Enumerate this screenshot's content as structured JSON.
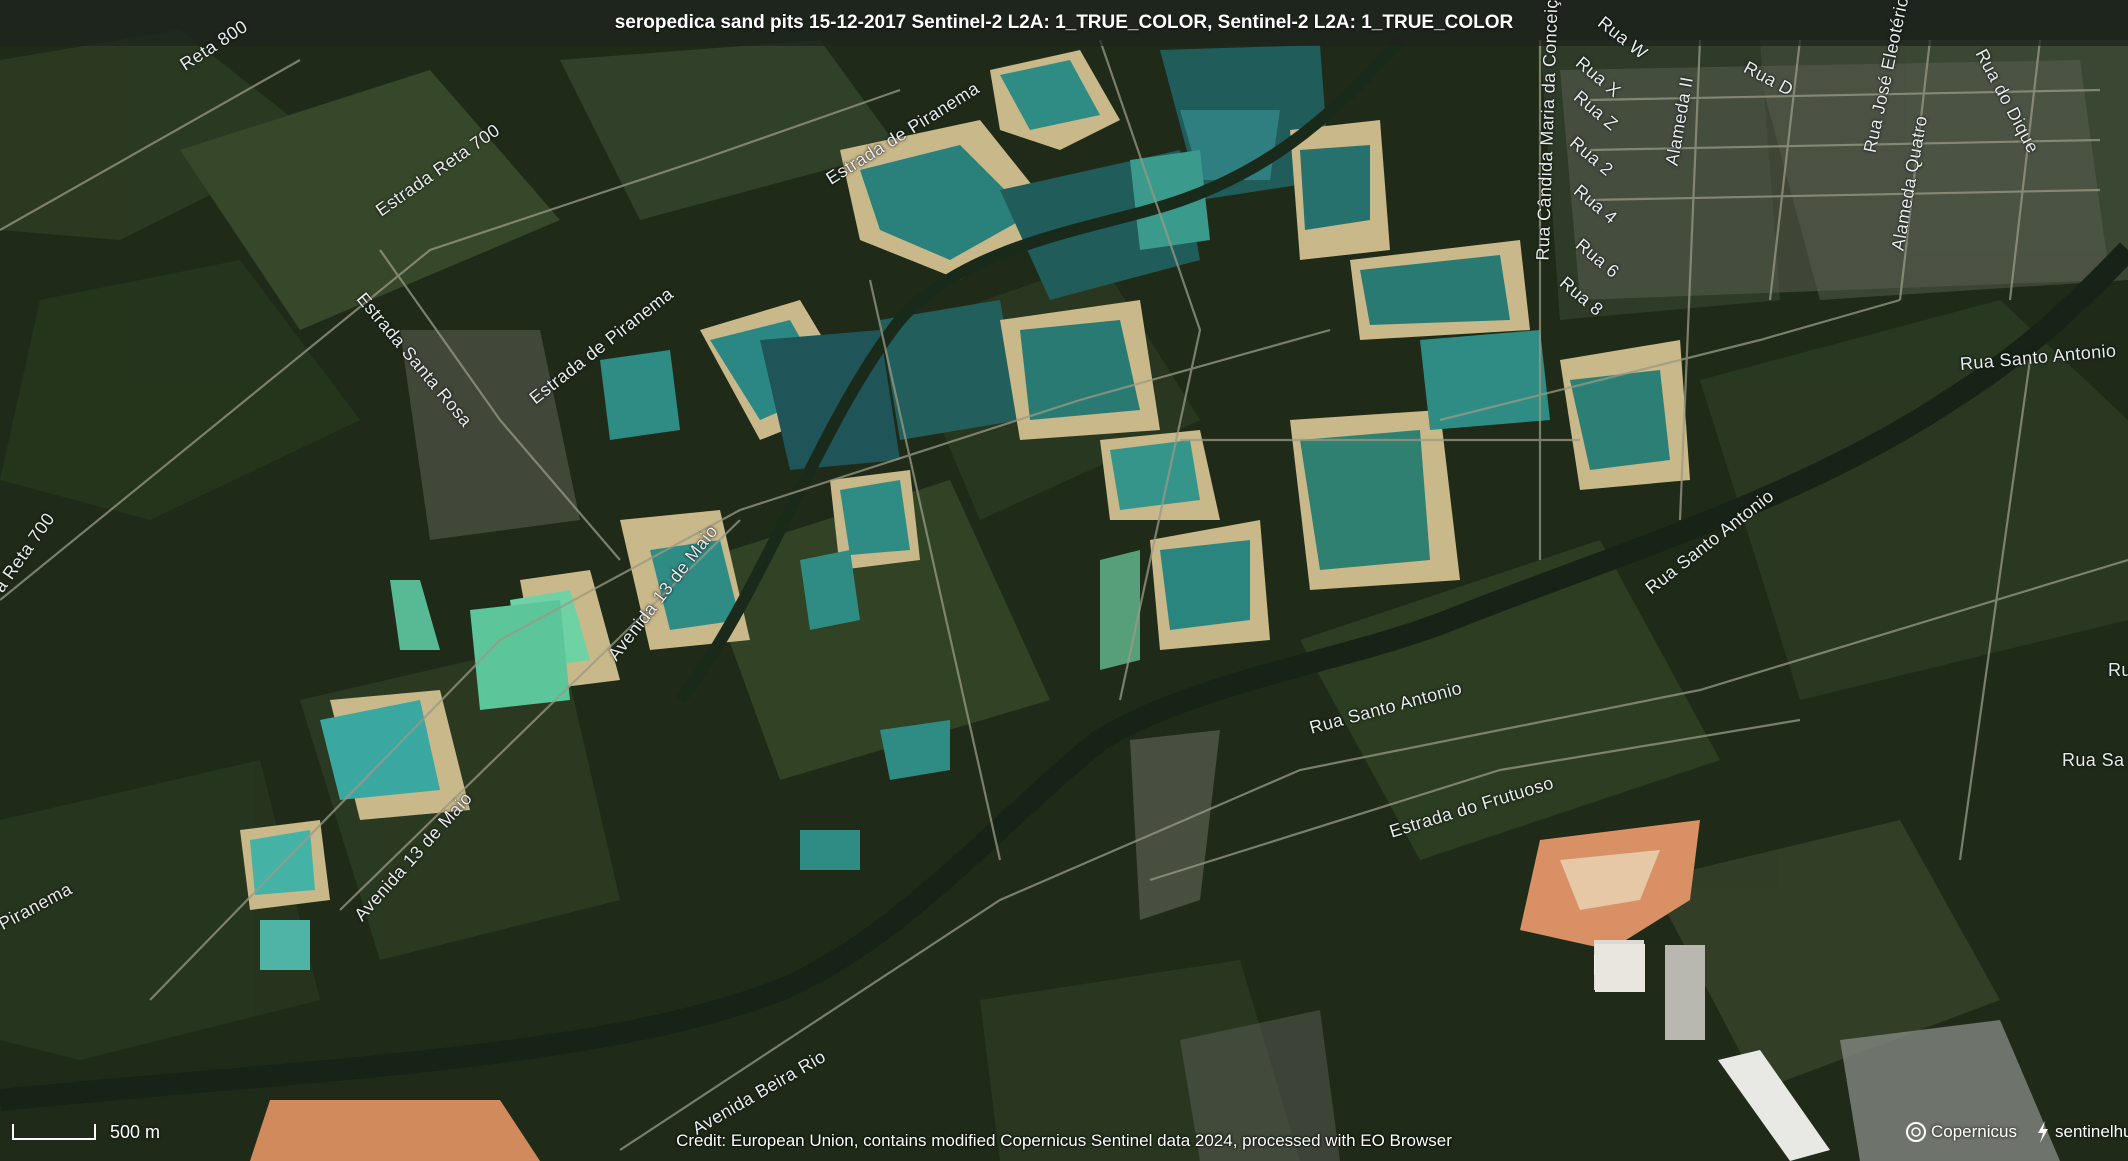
{
  "title": "seropedica sand pits 15-12-2017 Sentinel-2 L2A: 1_TRUE_COLOR, Sentinel-2 L2A: 1_TRUE_COLOR",
  "labels": {
    "reta800": "Reta 800",
    "reta700_top": "Estrada Reta 700",
    "reta700_left": "a Reta 700",
    "santa_rosa": "Estrada Santa Rosa",
    "piranema_1": "Estrada de Piranema",
    "piranema_2": "Estrada de Piranema",
    "piranema_3": "Piranema",
    "maio_1": "Avenida 13 de Maio",
    "maio_2": "Avenida 13 de Maio",
    "beira_rio": "Avenida Beira Rio",
    "santo_antonio_1": "Rua Santo Antonio",
    "santo_antonio_2": "Rua Santo Antonio",
    "santo_antonio_3": "Rua Santo Antonio",
    "frutuoso": "Estrada do Frutuoso",
    "candida": "Rua Cândida Maria da Conceição",
    "alameda_ii": "Alameda II",
    "alameda_quatro": "Alameda Quatro",
    "jose_eleoterio": "Rua José Eleotério",
    "dique": "Rua do Dique",
    "rua_w": "Rua W",
    "rua_x": "Rua X",
    "rua_z": "Rua Z",
    "rua_2": "Rua 2",
    "rua_4": "Rua 4",
    "rua_6": "Rua 6",
    "rua_8": "Rua 8",
    "rua_d": "Rua D",
    "rua_sa": "Rua Sa",
    "rua_r": "Ru"
  },
  "scale_label": "500 m",
  "credit": "Credit: European Union, contains modified Copernicus Sentinel data 2024, processed with EO Browser",
  "logos": {
    "copernicus": "Copernicus",
    "sentinelhub": "sentinelhub"
  },
  "colors": {
    "vegetation_dark": "#1e2a17",
    "vegetation": "#34452a",
    "pit_water_dark": "#1f5c5a",
    "pit_water": "#2f8c84",
    "pit_water_light": "#6fd2a4",
    "sand": "#c9b889",
    "bare_soil": "#d89064",
    "road": "#9a9a86"
  }
}
